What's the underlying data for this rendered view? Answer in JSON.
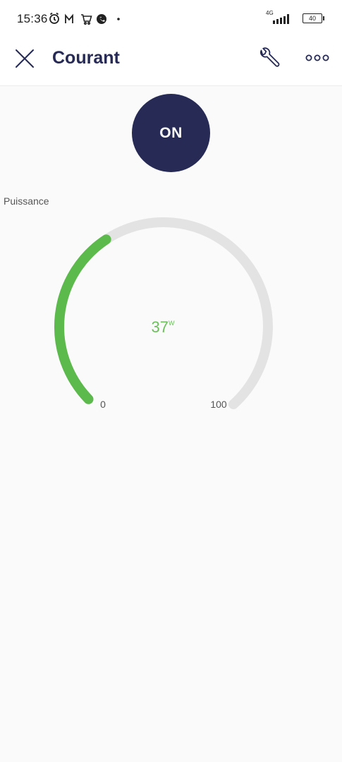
{
  "status_bar": {
    "time": "15:36",
    "network": "4G",
    "battery": "40",
    "icons": [
      "alarm-icon",
      "mail-icon",
      "cart-icon",
      "phone-icon",
      "dot-icon",
      "signal-icon",
      "battery-icon"
    ]
  },
  "header": {
    "close_icon": "close-icon",
    "title": "Courant",
    "settings_icon": "wrench-icon",
    "more_icon": "more-icon"
  },
  "power": {
    "label": "ON",
    "color": "#262a55"
  },
  "gauge": {
    "label": "Puissance",
    "value": 37,
    "value_text": "37",
    "unit": "W",
    "min": 0,
    "max": 100,
    "min_label": "0",
    "max_label": "100",
    "fill_color": "#5cb94b",
    "track_color": "#e3e3e3"
  }
}
